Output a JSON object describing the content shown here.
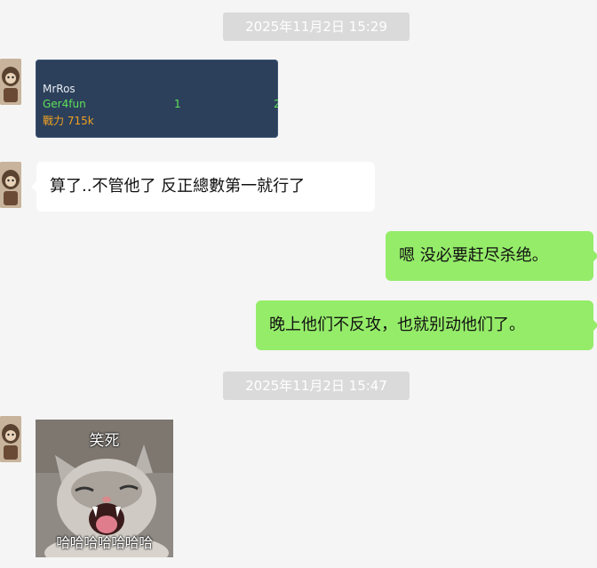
{
  "chat": {
    "timestamps": [
      "2025年11月2日 15:29",
      "2025年11月2日 15:47"
    ],
    "image_card": {
      "player_name": "MrRos",
      "guild": "Ger4fun",
      "power": "戰力 715k",
      "col1": "1",
      "col2": "2"
    },
    "messages": [
      {
        "side": "left",
        "text": "算了..不管他了  反正總數第一就行了"
      },
      {
        "side": "right",
        "text": "嗯 没必要赶尽杀绝。"
      },
      {
        "side": "right",
        "text": "晚上他们不反攻，也就别动他们了。"
      }
    ],
    "sticker": {
      "caption_top": "笑死",
      "caption_bottom": "哈哈哈哈哈哈哈"
    }
  },
  "colors": {
    "background": "#f5f5f5",
    "self_bubble": "#95ec69",
    "other_bubble": "#ffffff",
    "timestamp_bg": "#dadada"
  }
}
